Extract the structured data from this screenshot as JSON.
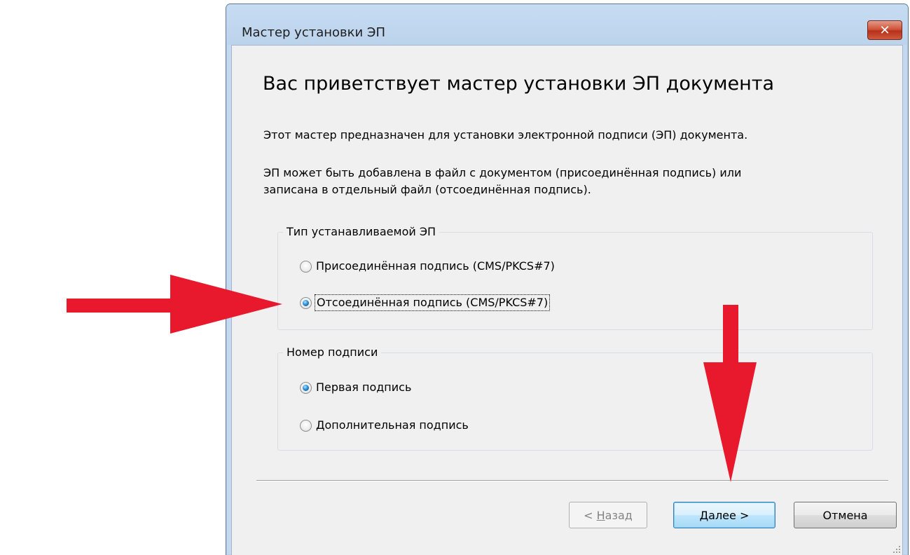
{
  "window": {
    "title": "Мастер установки ЭП",
    "close_glyph": "✕"
  },
  "content": {
    "heading": "Вас приветствует мастер установки ЭП документа",
    "para1": "Этот мастер предназначен для установки электронной подписи (ЭП) документа.",
    "para2_line1": "ЭП может быть добавлена в файл с документом (присоединённая подпись) или",
    "para2_line2": "записана в отдельный файл (отсоединённая подпись)."
  },
  "signature_type": {
    "legend": "Тип устанавливаемой ЭП",
    "options": [
      {
        "label": "Присоединённая подпись (CMS/PKCS#7)",
        "checked": false
      },
      {
        "label": "Отсоединённая подпись (CMS/PKCS#7)",
        "checked": true
      }
    ]
  },
  "signature_number": {
    "legend": "Номер подписи",
    "options": [
      {
        "label": "Первая подпись",
        "checked": true
      },
      {
        "label": "Дополнительная подпись",
        "checked": false
      }
    ]
  },
  "buttons": {
    "back_prefix": "< ",
    "back_underlined": "Н",
    "back_rest": "азад",
    "next_underlined": "Д",
    "next_rest": "алее >",
    "cancel": "Отмена"
  },
  "annotations": {
    "arrow_color": "#e8192c",
    "arrows": [
      "arrow-right-icon",
      "arrow-down-icon"
    ]
  }
}
